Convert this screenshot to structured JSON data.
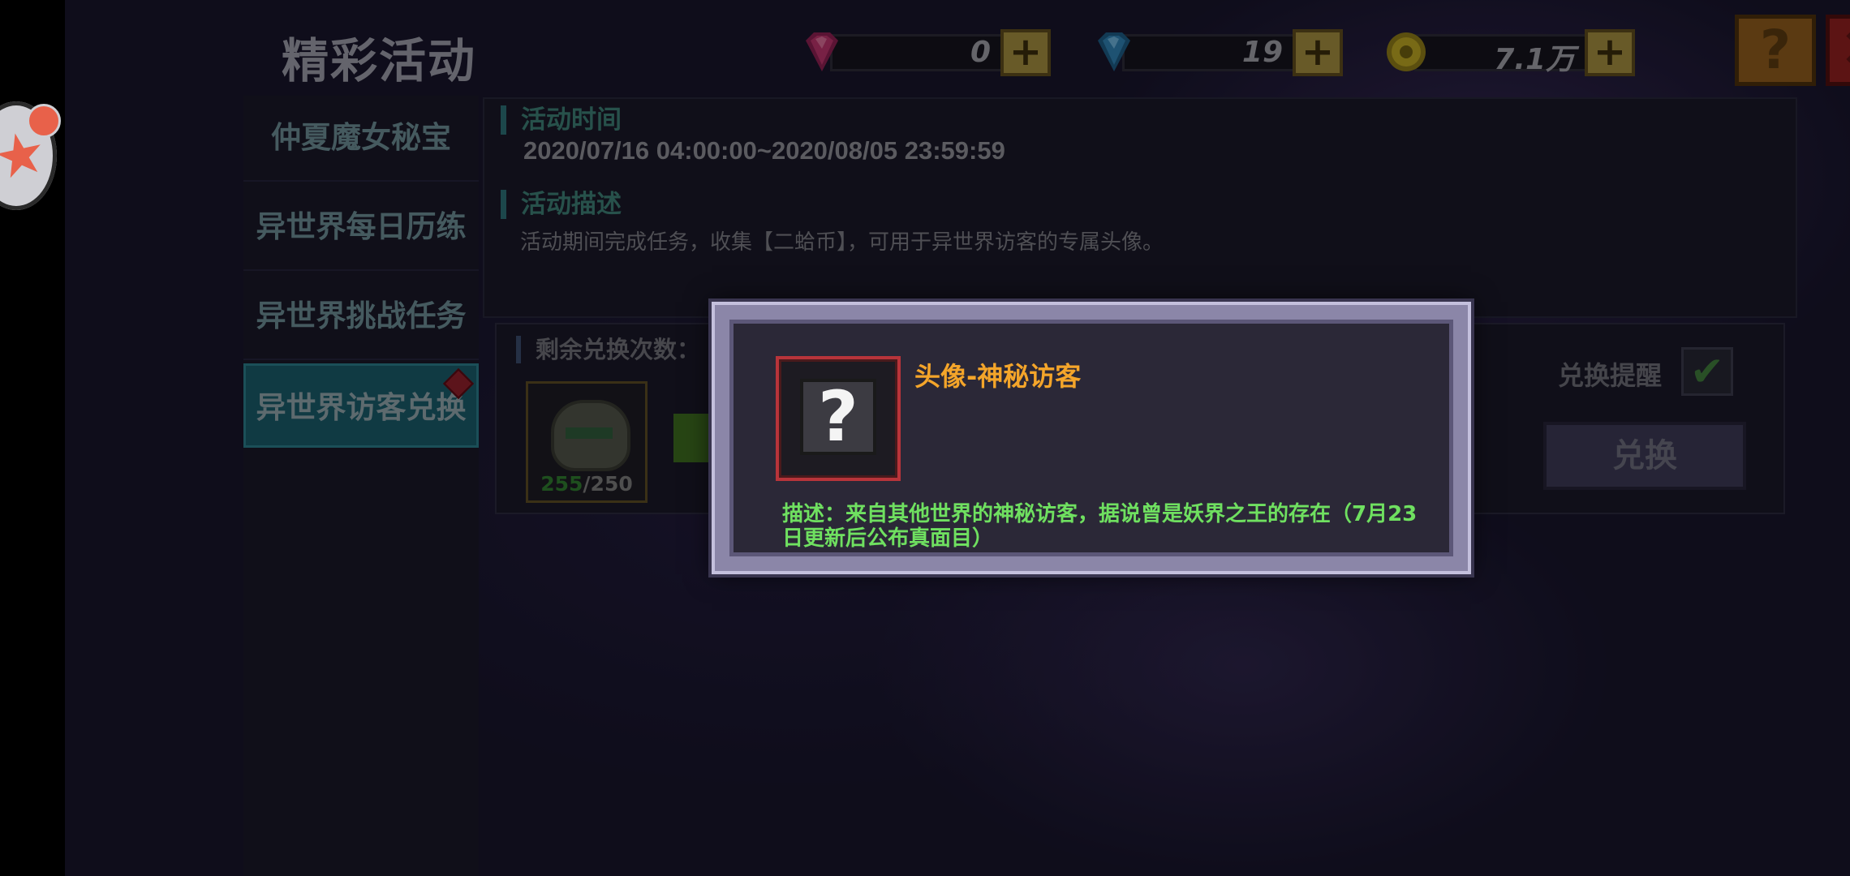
{
  "header": {
    "title": "精彩活动",
    "currencies": [
      {
        "icon": "pink-gem-icon",
        "value": "0",
        "color": "#b8336a"
      },
      {
        "icon": "blue-gem-icon",
        "value": "19",
        "color": "#2f7fb0"
      },
      {
        "icon": "gold-coin-icon",
        "value": "7.1万",
        "color": "#b8a322"
      }
    ],
    "plus": "+",
    "help": "?",
    "close": "✕"
  },
  "sidebar": {
    "items": [
      {
        "label": "仲夏魔女秘宝"
      },
      {
        "label": "异世界每日历练"
      },
      {
        "label": "异世界挑战任务"
      },
      {
        "label": "异世界访客兑换"
      }
    ]
  },
  "info": {
    "time_heading": "活动时间",
    "time_value": "2020/07/16 04:00:00~2020/08/05 23:59:59",
    "desc_heading": "活动描述",
    "desc_value": "活动期间完成任务，收集【二蛤币】，可用于异世界访客的专属头像。"
  },
  "exchange": {
    "remaining_label": "剩余兑换次数：",
    "have": "255",
    "need": "/250",
    "remind_label": "兑换提醒",
    "check": "✔",
    "button": "兑换"
  },
  "popup": {
    "icon_glyph": "?",
    "name": "头像-神秘访客",
    "description": "描述：来自其他世界的神秘访客，据说曾是妖界之王的存在（7月23日更新后公布真面目）"
  },
  "assist": {
    "glyph": "★"
  }
}
